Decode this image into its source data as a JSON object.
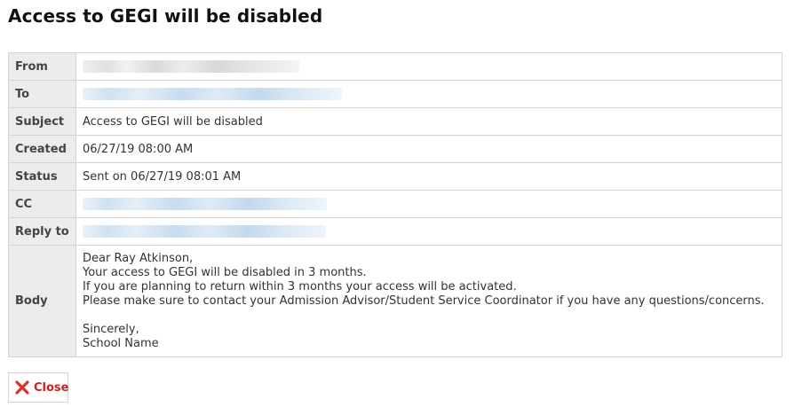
{
  "page": {
    "title": "Access to GEGI will be disabled"
  },
  "fields": {
    "from_label": "From",
    "to_label": "To",
    "subject_label": "Subject",
    "subject_value": "Access to GEGI will be disabled",
    "created_label": "Created",
    "created_value": "06/27/19 08:00 AM",
    "status_label": "Status",
    "status_value": "Sent on 06/27/19 08:01 AM",
    "cc_label": "CC",
    "reply_to_label": "Reply to",
    "body_label": "Body",
    "body_value": "Dear Ray Atkinson,\nYour access to GEGI will be disabled in 3 months.\nIf you are planning to return within 3 months your access will be activated.\nPlease make sure to contact your Admission Advisor/Student Service Coordinator if you have any questions/concerns.\n\nSincerely,\nSchool Name"
  },
  "actions": {
    "close_label": "Close"
  },
  "colors": {
    "close_text": "#cc2222",
    "label_bg": "#ececec",
    "border": "#d4d4d4"
  },
  "icons": {
    "close": "close-x-icon"
  }
}
